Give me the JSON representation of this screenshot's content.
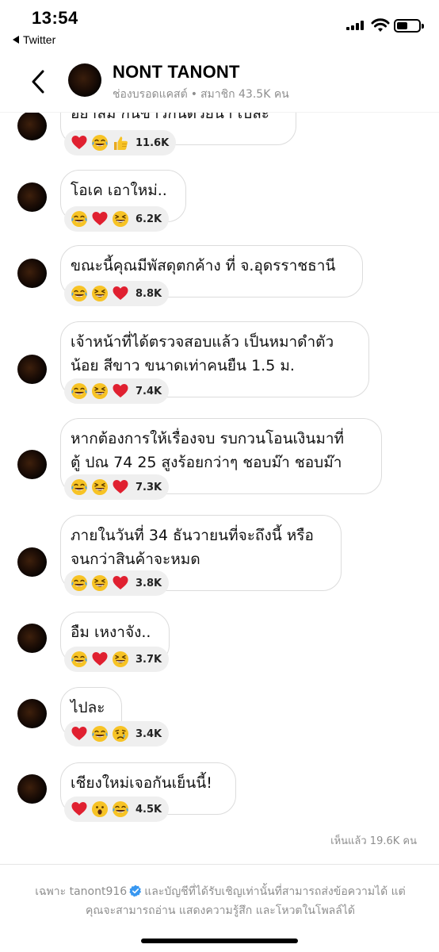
{
  "status_bar": {
    "time": "13:54",
    "back_app": "Twitter"
  },
  "header": {
    "title": "NONT TANONT",
    "subtitle_type": "ช่องบรอดแคสต์",
    "subtitle_members": "สมาชิก 43.5K คน"
  },
  "messages": [
    {
      "lines": [
        "อย่าลืม กินข้าวกินด้วยน้า เปละ"
      ],
      "reactions": [
        "heart",
        "laugh",
        "thumbs"
      ],
      "count": "11.6K"
    },
    {
      "lines": [
        "โอเค เอาใหม่.."
      ],
      "reactions": [
        "laugh",
        "heart",
        "grin"
      ],
      "count": "6.2K"
    },
    {
      "lines": [
        "ขณะนี้คุณมีพัสดุตกค้าง ที่ จ.อุดรราชธานี"
      ],
      "reactions": [
        "laugh",
        "grin",
        "heart"
      ],
      "count": "8.8K"
    },
    {
      "lines": [
        "เจ้าหน้าที่ได้ตรวจสอบแล้ว เป็นหมาดำตัว",
        "น้อย สีขาว ขนาดเท่าคนยืน 1.5 ม."
      ],
      "reactions": [
        "laugh",
        "grin",
        "heart"
      ],
      "count": "7.4K"
    },
    {
      "lines": [
        "หากต้องการให้เรื่องจบ รบกวนโอนเงินมาที่",
        "ตู้ ปณ 74 25 สูงร้อยกว่าๆ ชอบม๊า ชอบม๊า"
      ],
      "reactions": [
        "laugh",
        "grin",
        "heart"
      ],
      "count": "7.3K"
    },
    {
      "lines": [
        "ภายในวันที่ 34 ธันวายนที่จะถึงนี้ หรือ",
        "จนกว่าสินค้าจะหมด"
      ],
      "reactions": [
        "laugh",
        "grin",
        "heart"
      ],
      "count": "3.8K"
    },
    {
      "lines": [
        "อืม เหงาจัง.."
      ],
      "reactions": [
        "laugh",
        "heart",
        "grin"
      ],
      "count": "3.7K"
    },
    {
      "lines": [
        "ไปละ"
      ],
      "reactions": [
        "heart",
        "laugh",
        "cry"
      ],
      "count": "3.4K"
    },
    {
      "lines": [
        "เชียงใหม่เจอกันเย็นนี้!"
      ],
      "reactions": [
        "heart",
        "wow",
        "laugh"
      ],
      "count": "4.5K"
    }
  ],
  "seen": "เห็นแล้ว 19.6K คน",
  "footer": {
    "prefix": "เฉพาะ tanont916",
    "line1_rest": "และบัญชีที่ได้รับเชิญเท่านั้นที่สามารถส่งข้อความได้ แต่",
    "line2": "คุณจะสามารถอ่าน แสดงความรู้สึก และโหวตในโพลล์ได้"
  },
  "colors": {
    "verified": "#3897f0",
    "muted_text": "#8e8e8e",
    "bubble_border": "#dcdcdc",
    "reaction_bg": "#efefef"
  }
}
